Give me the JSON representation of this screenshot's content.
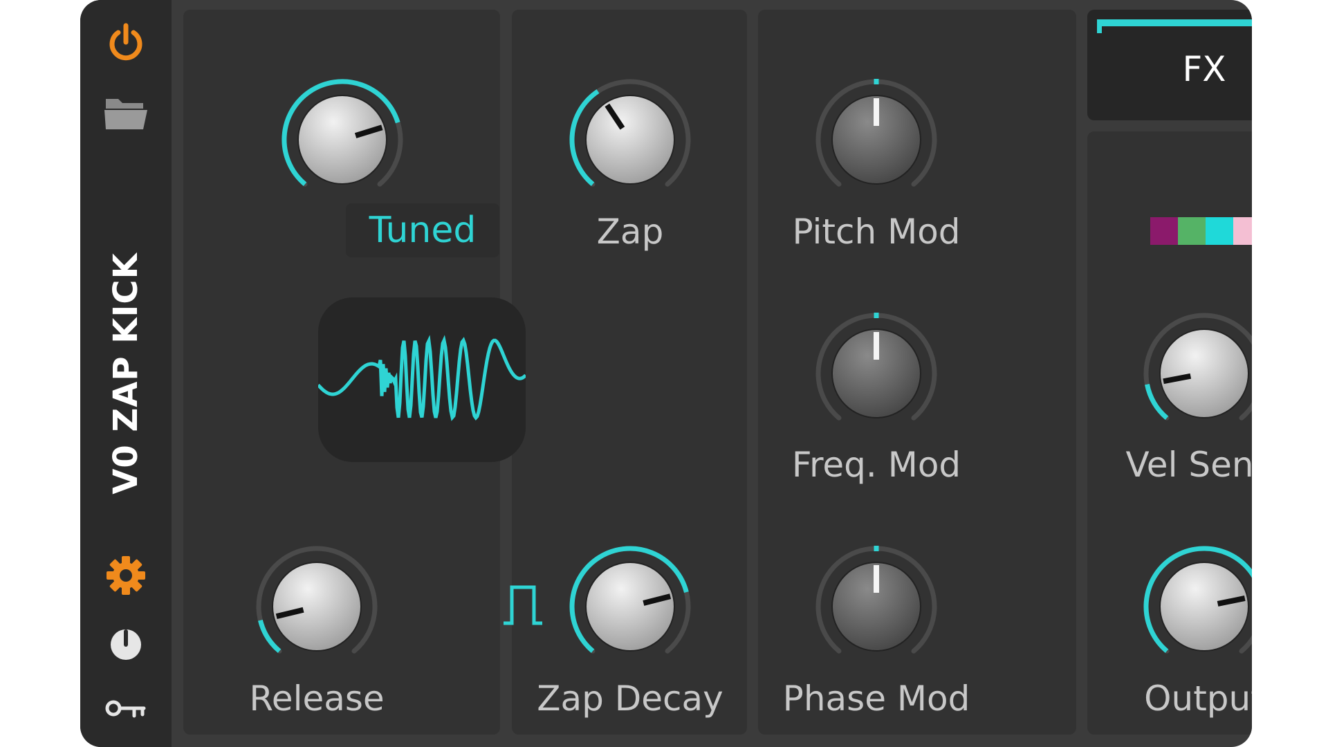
{
  "device": {
    "title": "V0 ZAP KICK"
  },
  "sidebar": {
    "icons": [
      "power-icon",
      "folder-icon",
      "gear-icon",
      "dial-icon",
      "key-icon"
    ],
    "power_color": "#f08a1c",
    "gear_color": "#f08a1c"
  },
  "accent_color": "#2fd4d4",
  "knobs": {
    "tuned": {
      "label": "Tuned",
      "value": 0.76,
      "style": "light",
      "bipolar": false
    },
    "release": {
      "label": "Release",
      "value": 0.13,
      "style": "light",
      "bipolar": false
    },
    "zap": {
      "label": "Zap",
      "value": 0.38,
      "style": "light",
      "bipolar": false
    },
    "zap_decay": {
      "label": "Zap Decay",
      "value": 0.77,
      "style": "light",
      "bipolar": false
    },
    "pitch_mod": {
      "label": "Pitch Mod",
      "value": 0.5,
      "style": "dark",
      "bipolar": true
    },
    "freq_mod": {
      "label": "Freq. Mod",
      "value": 0.5,
      "style": "dark",
      "bipolar": true
    },
    "phase_mod": {
      "label": "Phase Mod",
      "value": 0.5,
      "style": "dark",
      "bipolar": true
    },
    "vel_sens": {
      "label": "Vel Sens.",
      "value": 0.14,
      "style": "light",
      "bipolar": false
    },
    "output": {
      "label": "Output",
      "value": 0.78,
      "style": "light",
      "bipolar": false
    }
  },
  "fx_tab": {
    "label": "FX"
  },
  "color_swatches": [
    "#8b1a6b",
    "#55b366",
    "#1fd9d9",
    "#f4bfd3"
  ],
  "waveform": {
    "icon": "waveform-display"
  },
  "gate_toggle": {
    "icon": "gate-pulse-icon"
  }
}
